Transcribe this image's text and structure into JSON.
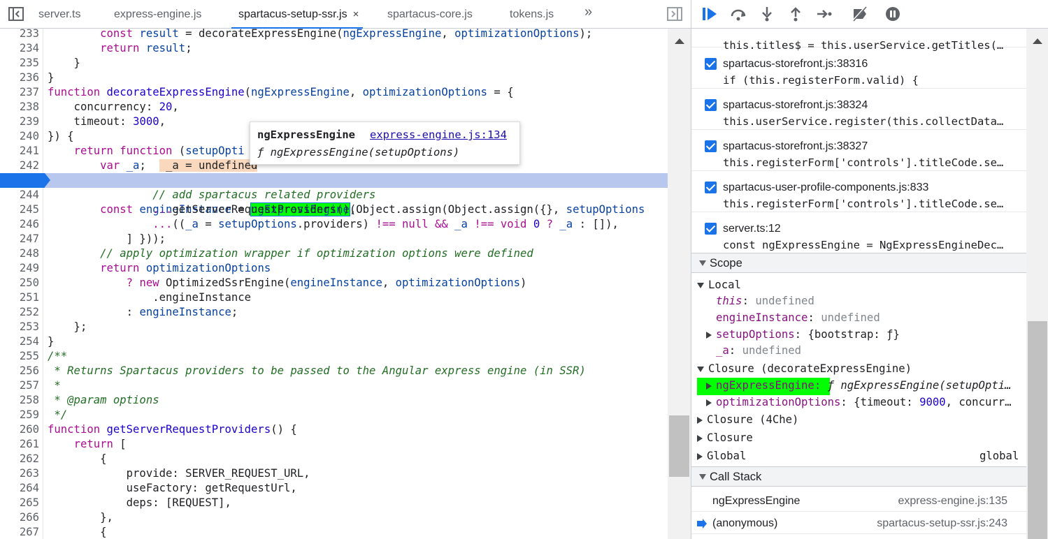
{
  "editor": {
    "tabs": [
      {
        "label": "server.ts",
        "active": false
      },
      {
        "label": "express-engine.js",
        "active": false
      },
      {
        "label": "spartacus-setup-ssr.js",
        "active": true
      },
      {
        "label": "spartacus-core.js",
        "active": false
      },
      {
        "label": "tokens.js",
        "active": false
      }
    ],
    "close_glyph": "×",
    "more_glyph": "»",
    "line_numbers": [
      "233",
      "234",
      "235",
      "236",
      "237",
      "238",
      "239",
      "240",
      "241",
      "242",
      "243",
      "244",
      "245",
      "246",
      "247",
      "248",
      "249",
      "250",
      "251",
      "252",
      "253",
      "254",
      "255",
      "256",
      "257",
      "258",
      "259",
      "260",
      "261",
      "262",
      "263",
      "264",
      "265",
      "266",
      "267"
    ],
    "current_line": "243",
    "popover": {
      "title": "ngExpressEngine",
      "link": "express-engine.js:134",
      "signature": "ƒ ngExpressEngine(setupOptions)"
    }
  },
  "debugger": {
    "breakpoints": [
      {
        "file": "",
        "code": "this.titles$ = this.userService.getTitles(…"
      },
      {
        "file": "spartacus-storefront.js:38316",
        "code": "if (this.registerForm.valid) {"
      },
      {
        "file": "spartacus-storefront.js:38324",
        "code": "this.userService.register(this.collectData…"
      },
      {
        "file": "spartacus-storefront.js:38327",
        "code": "this.registerForm['controls'].titleCode.se…"
      },
      {
        "file": "spartacus-user-profile-components.js:833",
        "code": "this.registerForm['controls'].titleCode.se…"
      },
      {
        "file": "server.ts:12",
        "code": "const ngExpressEngine = NgExpressEngineDec…"
      }
    ],
    "scope": {
      "title": "Scope",
      "local_label": "Local",
      "local": [
        {
          "name": "this",
          "value": "undefined"
        },
        {
          "name": "engineInstance",
          "value": "undefined"
        },
        {
          "name": "setupOptions",
          "value": "{bootstrap: ƒ}"
        },
        {
          "name": "_a",
          "value": "undefined"
        }
      ],
      "closure_label": "Closure (decorateExpressEngine)",
      "closure": [
        {
          "name": "ngExpressEngine:",
          "value": "ƒ ngExpressEngine(setupOpti…"
        },
        {
          "name": "optimizationOptions",
          "value_prefix": "{timeout: ",
          "value_num": "9000",
          "value_suffix": ", concurr…"
        }
      ],
      "others": [
        "Closure (4Che)",
        "Closure",
        "Global"
      ],
      "global_value": "global"
    },
    "call_stack": {
      "title": "Call Stack",
      "frames": [
        {
          "name": "ngExpressEngine",
          "location": "express-engine.js:135"
        },
        {
          "name": "(anonymous)",
          "location": "spartacus-setup-ssr.js:243"
        }
      ]
    }
  },
  "colors": {
    "accent": "#1a73e8",
    "highlight_line": "#b8c7ee",
    "green_highlight": "#00ff00",
    "keyword": "#aa0d91",
    "comment": "#236e25"
  }
}
